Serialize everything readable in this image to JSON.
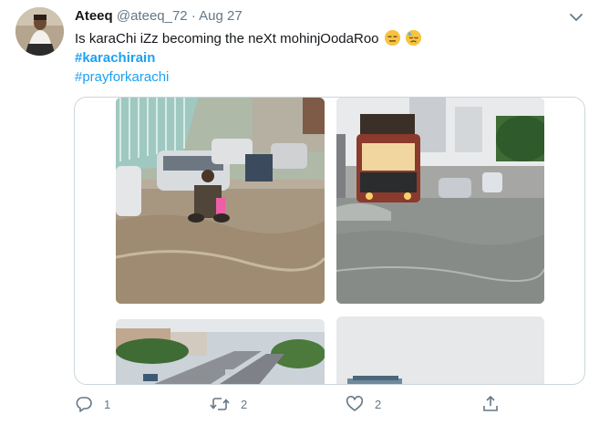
{
  "tweet": {
    "display_name": "Ateeq",
    "handle": "@ateeq_72",
    "separator": "·",
    "date": "Aug 27",
    "text": "Is karaChi iZz becoming   the neXt mohinjOodaRoo",
    "emojis": [
      "expressionless-face",
      "downcast-face-with-sweat"
    ],
    "hashtags": [
      "#karachirain",
      "#prayforkarachi"
    ]
  },
  "media": {
    "photos": [
      {
        "name": "flooded-road-with-motorcyclists"
      },
      {
        "name": "bus-in-floodwater"
      },
      {
        "name": "aerial-flooded-highway"
      },
      {
        "name": "overcast-sky-with-vehicle"
      }
    ]
  },
  "actions": {
    "reply_count": "1",
    "retweet_count": "2",
    "like_count": "2",
    "icons": [
      "reply-icon",
      "retweet-icon",
      "like-icon",
      "share-icon"
    ]
  },
  "colors": {
    "link": "#1da1f2",
    "secondary_text": "#657786",
    "border": "#ccd6dd"
  }
}
